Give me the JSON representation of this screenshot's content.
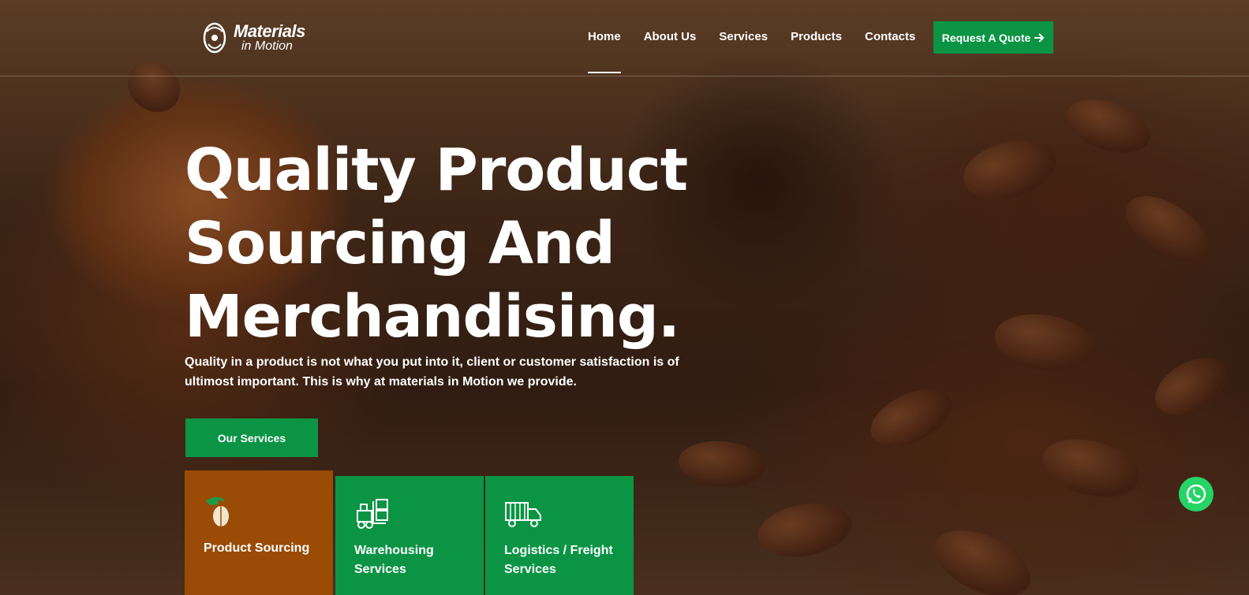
{
  "brand": {
    "name_line1": "Materials",
    "name_line2": "in Motion",
    "logo_icon": "cocoa-logo-icon"
  },
  "nav": {
    "items": [
      {
        "label": "Home",
        "active": true
      },
      {
        "label": "About Us",
        "active": false
      },
      {
        "label": "Services",
        "active": false
      },
      {
        "label": "Products",
        "active": false
      },
      {
        "label": "Contacts",
        "active": false
      }
    ],
    "quote_button": "Request A Quote",
    "quote_icon": "arrow-right-icon"
  },
  "hero": {
    "title_line1": "Quality Product",
    "title_line2": "Sourcing And",
    "title_line3": "Merchandising.",
    "description": "Quality in a product is not what you put into it, client or customer satisfaction is of ultimost important. This is why at materials in Motion we provide.",
    "cta_label": "Our Services"
  },
  "service_cards": [
    {
      "label": "Product Sourcing",
      "icon": "cocoa-pod-icon",
      "color": "#9a4b06"
    },
    {
      "label": "Warehousing Services",
      "icon": "forklift-icon",
      "color": "#0b9444"
    },
    {
      "label": "Logistics / Freight Services",
      "icon": "delivery-truck-icon",
      "color": "#0b9444"
    }
  ],
  "floating": {
    "whatsapp_icon": "whatsapp-icon"
  },
  "colors": {
    "accent": "#0b9444",
    "card_brown": "#9a4b06",
    "text": "#ffffff"
  }
}
